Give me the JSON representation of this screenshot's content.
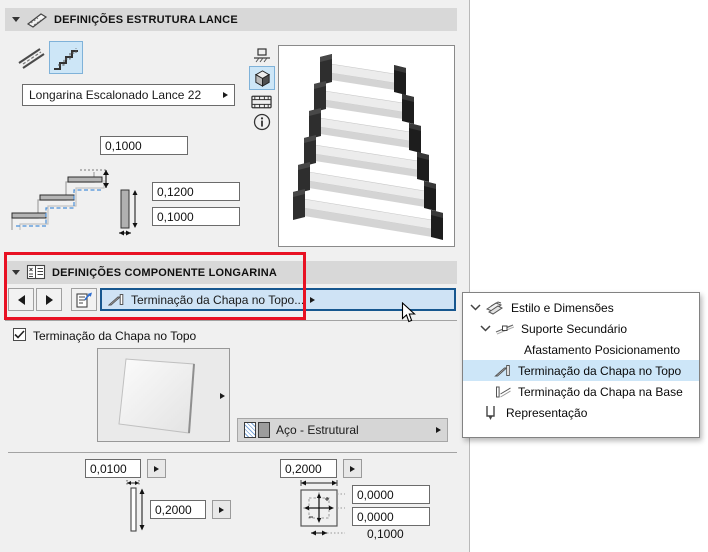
{
  "colors": {
    "panel_bg": "#f0f0f0",
    "header_bar": "#d8d8d8",
    "accent_dropdown_bg": "#cfe3f5",
    "accent_dropdown_border": "#17578f",
    "selected_toggle_bg": "#cde6f7",
    "popup_highlight": "#cde6f8",
    "annotation_red": "#e81123"
  },
  "section_flight": {
    "title": "DEFINIÇÕES ESTRUTURA LANCE",
    "structure_type": "Longarina Escalonado Lance 22",
    "toggle_icons": [
      "flat-stringer-icon",
      "stepped-stringer-icon"
    ],
    "selected_toggle": "stepped-stringer-icon",
    "offset_value": "0,1000",
    "profile_height_value": "0,1200",
    "profile_width_value": "0,1000",
    "preview_modes": [
      "plan-symbol-icon",
      "cube-3d-icon",
      "section-film-icon",
      "info-icon"
    ],
    "selected_preview_mode": "cube-3d-icon"
  },
  "section_component": {
    "title": "DEFINIÇÕES COMPONENTE LONGARINA",
    "page_selector_value": "Terminação da Chapa no Topo...",
    "checkbox_label": "Terminação da Chapa no Topo",
    "checkbox_checked": true,
    "material_value": "Aço - Estrutural",
    "plate_thickness": "0,0100",
    "plate_height": "0,2000",
    "plate_width": "0,2000",
    "offset_x": "0,0000",
    "offset_y": "0,0000",
    "offset_ref": "0,1000"
  },
  "popup_menu": {
    "items": [
      {
        "label": "Estilo e Dimensões",
        "icon": "style-dimensions-icon",
        "expanded": true,
        "selected": false
      },
      {
        "label": "Suporte Secundário",
        "icon": "secondary-support-icon",
        "expanded": true,
        "selected": false
      },
      {
        "label": "Afastamento Posicionamento",
        "icon": null,
        "selected": false
      },
      {
        "label": "Terminação da Chapa no Topo",
        "icon": "plate-top-icon",
        "selected": true
      },
      {
        "label": "Terminação da Chapa na Base",
        "icon": "plate-base-icon",
        "selected": false
      },
      {
        "label": "Representação",
        "icon": "representation-icon",
        "selected": false
      }
    ]
  }
}
